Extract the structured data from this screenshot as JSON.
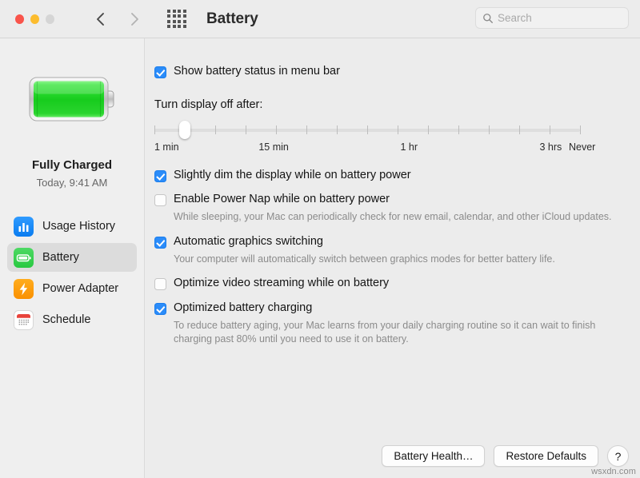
{
  "window": {
    "title": "Battery",
    "traffic_lights": [
      "close",
      "minimize",
      "zoom"
    ],
    "nav_back": "back-chevron",
    "nav_forward": "forward-chevron",
    "grid_button": "show-all-preferences"
  },
  "search": {
    "placeholder": "Search",
    "value": ""
  },
  "sidebar": {
    "battery_status": {
      "title": "Fully Charged",
      "subtitle": "Today, 9:41 AM",
      "charge_percent": 100
    },
    "items": [
      {
        "label": "Usage History",
        "icon": "usage-history-icon",
        "selected": false
      },
      {
        "label": "Battery",
        "icon": "battery-icon",
        "selected": true
      },
      {
        "label": "Power Adapter",
        "icon": "power-adapter-icon",
        "selected": false
      },
      {
        "label": "Schedule",
        "icon": "schedule-icon",
        "selected": false
      }
    ]
  },
  "main": {
    "menu_bar_option": {
      "label": "Show battery status in menu bar",
      "checked": true
    },
    "display_off": {
      "label": "Turn display off after:",
      "tick_count": 15,
      "value_index": 1,
      "labels": [
        {
          "text": "1 min",
          "pos": 0
        },
        {
          "text": "15 min",
          "pos": 0.245
        },
        {
          "text": "1 hr",
          "pos": 0.578
        },
        {
          "text": "3 hrs",
          "pos": 0.905
        },
        {
          "text": "Never",
          "pos": 1.0
        }
      ]
    },
    "options": [
      {
        "label": "Slightly dim the display while on battery power",
        "checked": true,
        "hint": ""
      },
      {
        "label": "Enable Power Nap while on battery power",
        "checked": false,
        "hint": "While sleeping, your Mac can periodically check for new email, calendar, and other iCloud updates."
      },
      {
        "label": "Automatic graphics switching",
        "checked": true,
        "hint": "Your computer will automatically switch between graphics modes for better battery life."
      },
      {
        "label": "Optimize video streaming while on battery",
        "checked": false,
        "hint": ""
      },
      {
        "label": "Optimized battery charging",
        "checked": true,
        "hint": "To reduce battery aging, your Mac learns from your daily charging routine so it can wait to finish charging past 80% until you need to use it on battery."
      }
    ]
  },
  "footer": {
    "battery_health": "Battery Health…",
    "restore_defaults": "Restore Defaults",
    "help": "?"
  },
  "watermark": "wsxdn.com",
  "colors": {
    "accent_blue": "#2b8cf9",
    "battery_green": "#35d839",
    "window_bg": "#ececec",
    "sidebar_bg": "#efefef",
    "selected_row": "#dcdcdc"
  }
}
